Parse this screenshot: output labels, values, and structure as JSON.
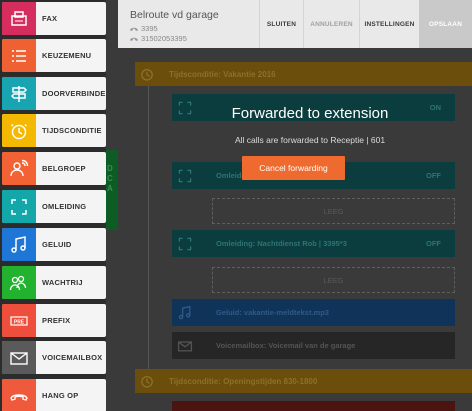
{
  "sidebar": {
    "items": [
      {
        "label": "FAX",
        "icon": "fax-icon",
        "color": "#d62d5f"
      },
      {
        "label": "KEUZEMENU",
        "icon": "menu-list-icon",
        "color": "#ef6032"
      },
      {
        "label": "DOORVERBINDEN",
        "icon": "signpost-icon",
        "color": "#18a4b0"
      },
      {
        "label": "TIJDSCONDITIE",
        "icon": "clock-icon",
        "color": "#f4b800"
      },
      {
        "label": "BELGROEP",
        "icon": "group-call-icon",
        "color": "#f26234"
      },
      {
        "label": "OMLEIDING",
        "icon": "redirect-icon",
        "color": "#14a7a9"
      },
      {
        "label": "GELUID",
        "icon": "music-note-icon",
        "color": "#1e76d6"
      },
      {
        "label": "WACHTRIJ",
        "icon": "queue-icon",
        "color": "#22b22f"
      },
      {
        "label": "PREFIX",
        "icon": "prefix-icon",
        "color": "#ee4e3c"
      },
      {
        "label": "VOICEMAILBOX",
        "icon": "voicemail-icon",
        "color": "#5a5a5a"
      },
      {
        "label": "HANG OP",
        "icon": "hang-up-icon",
        "color": "#f05a3c"
      }
    ]
  },
  "header": {
    "title": "Belroute vd garage",
    "extension": "3395",
    "number": "31502053395",
    "buttons": {
      "close": "SLUITEN",
      "cancel": "ANNULEREN",
      "settings": "INSTELLINGEN",
      "save": "OPSLAAN"
    }
  },
  "modal": {
    "title": "Forwarded to extension",
    "message": "All calls are forwarded to Receptie | 601",
    "button": "Cancel forwarding"
  },
  "flow": {
    "condition_1": "Tijdsconditie: Vakantie 2016",
    "node_1_state": "ON",
    "node_2_label": "Omleiding: ...2",
    "node_2_state": "OFF",
    "empty_1": "LEEG",
    "node_3_label": "Omleiding: Nachtdienst Rob | 3395*3",
    "node_3_state": "OFF",
    "empty_2": "LEEG",
    "node_4_label": "Geluid: vakantie-meldtekst.mp3",
    "node_5_label": "Voicemailbox: Voicemail van de garage",
    "condition_2": "Tijdsconditie: Openingstijden 830-1800"
  },
  "peek_text": [
    "D",
    "C",
    "A"
  ]
}
